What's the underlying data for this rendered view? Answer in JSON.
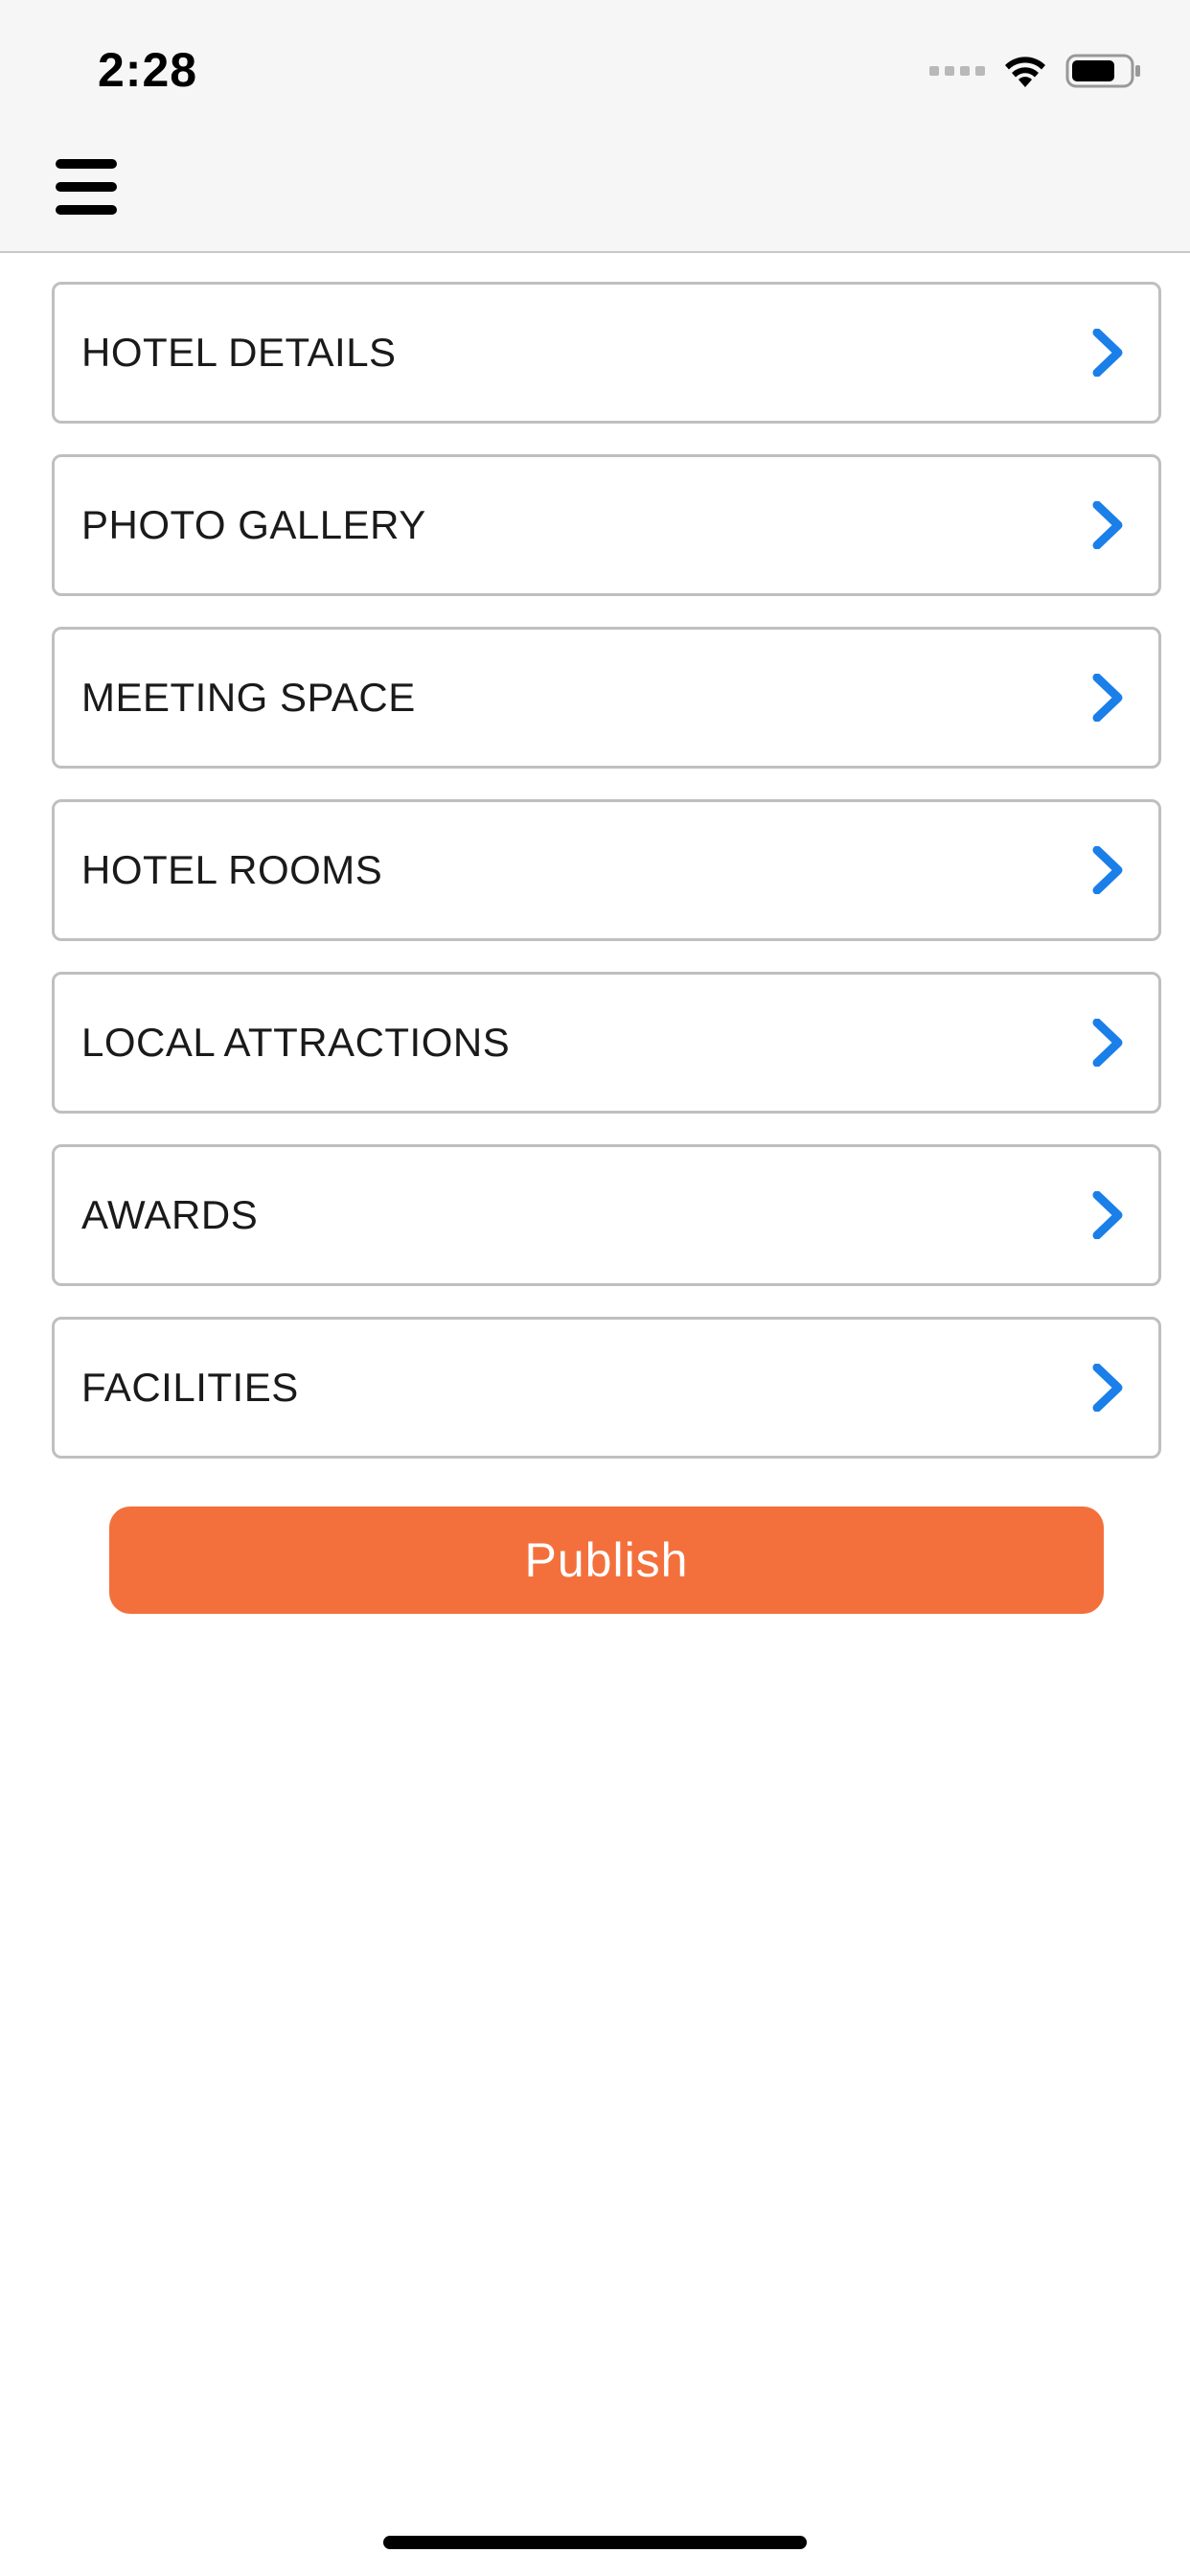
{
  "status_bar": {
    "time": "2:28",
    "icons": [
      "signal-dots-icon",
      "wifi-icon",
      "battery-icon"
    ]
  },
  "nav": {
    "menu_icon": "hamburger-menu-icon"
  },
  "sections": [
    {
      "label": "HOTEL DETAILS"
    },
    {
      "label": "PHOTO GALLERY"
    },
    {
      "label": "MEETING SPACE"
    },
    {
      "label": "HOTEL ROOMS"
    },
    {
      "label": "LOCAL ATTRACTIONS"
    },
    {
      "label": "AWARDS"
    },
    {
      "label": "FACILITIES"
    }
  ],
  "publish_button": {
    "label": "Publish"
  },
  "colors": {
    "accent_orange": "#f3703c",
    "chevron_blue": "#1a7fe8",
    "border_gray": "#bfbfbf",
    "nav_background": "#f6f6f6"
  }
}
